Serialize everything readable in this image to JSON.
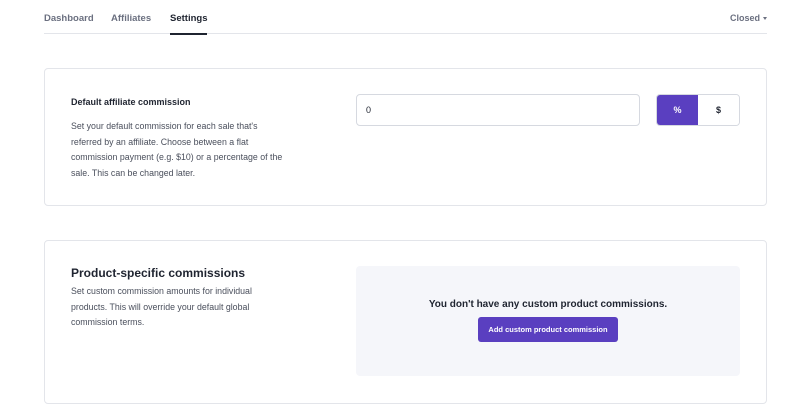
{
  "nav": {
    "tabs": [
      {
        "label": "Dashboard",
        "active": false
      },
      {
        "label": "Affiliates",
        "active": false
      },
      {
        "label": "Settings",
        "active": true
      }
    ],
    "status_label": "Closed",
    "status_icon": "chevron-down-icon"
  },
  "default_commission": {
    "title": "Default affiliate commission",
    "description": "Set your default commission for each sale that's referred by an affiliate. Choose between a flat commission payment (e.g. $10) or a percentage of the sale. This can be changed later.",
    "value": "0",
    "type_options": [
      {
        "label": "%",
        "selected": true
      },
      {
        "label": "$",
        "selected": false
      }
    ]
  },
  "product_commissions": {
    "title": "Product-specific commissions",
    "description": "Set custom commission amounts for individual products. This will override your default global commission terms.",
    "empty_message": "You don't have any custom product commissions.",
    "add_button_label": "Add custom product commission"
  },
  "colors": {
    "accent": "#5a3fc0",
    "panel_background": "#f5f6fa",
    "border": "#e3e5ea"
  }
}
